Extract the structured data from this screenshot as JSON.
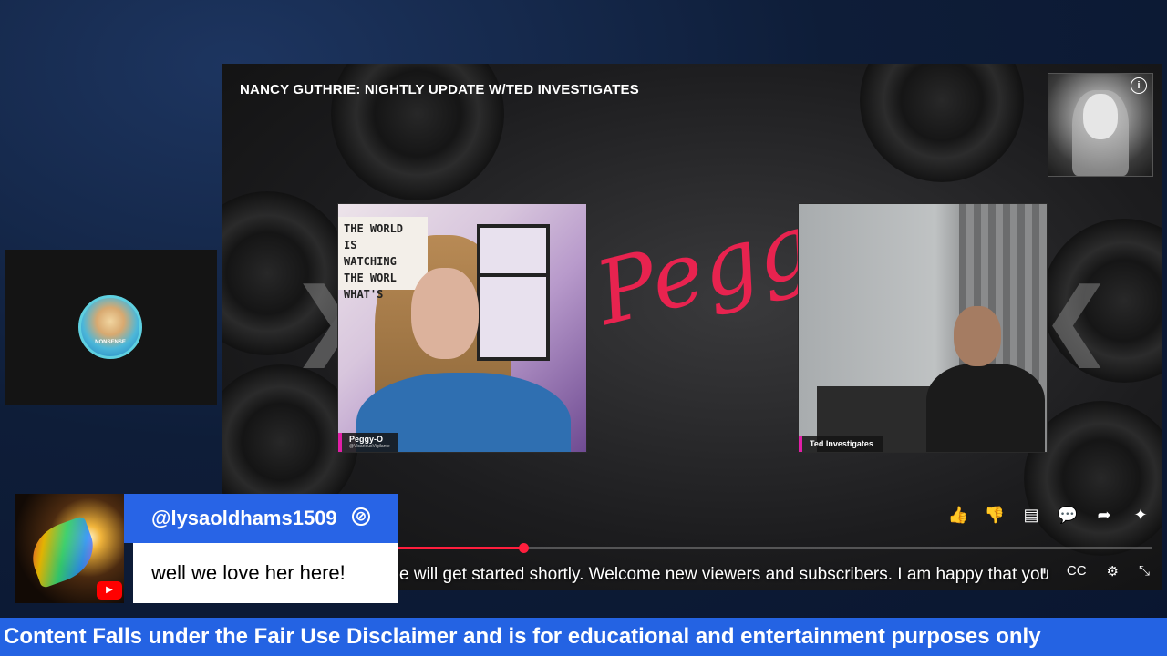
{
  "player": {
    "title": "NANCY GUTHRIE: NIGHTLY UPDATE W/TED INVESTIGATES",
    "info_glyph": "i",
    "brand_text": "Peggy-",
    "caption": "e will get started shortly. Welcome new viewers and subscribers. I am happy that you",
    "progress": 0.18,
    "left_guest": {
      "name": "Peggy-O",
      "handle": "@VicariousVigilante",
      "sign_text": [
        "THE WORLD IS",
        "WATCHING",
        "THE WORL",
        "WHAT'S"
      ]
    },
    "right_guest": {
      "name": "Ted Investigates"
    },
    "actions": [
      "like-icon",
      "dislike-icon",
      "comment-icon",
      "chat-icon",
      "share-icon",
      "sparkle-icon"
    ],
    "action_glyphs": [
      "👍",
      "👎",
      "▤",
      "💬",
      "➦",
      "✦"
    ],
    "controls": [
      "pause-icon",
      "cc-icon",
      "settings-icon",
      "fullscreen-icon"
    ],
    "control_glyphs": [
      "⏸",
      "CC",
      "⚙",
      "⤡"
    ]
  },
  "side_panel": {
    "avatar_label": "NONSENSE"
  },
  "chat": {
    "username": "@lysaoldhams1509",
    "message": "well we love her here!",
    "platform": "youtube-icon",
    "verified_glyph": "⊘"
  },
  "banner": {
    "text": "Content Falls under the Fair Use Disclaimer and is for educational and entertainment purposes only"
  },
  "colors": {
    "accent_blue": "#2463e3",
    "progress_red": "#ff1e3d",
    "brand_red": "#e8234f",
    "nameplate_pink": "#e21fa8"
  }
}
